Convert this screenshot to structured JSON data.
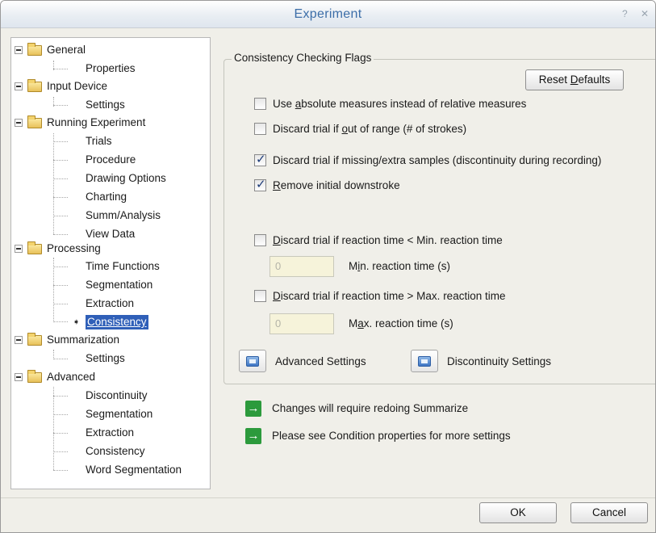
{
  "window": {
    "title": "Experiment",
    "help_glyph": "?",
    "close_glyph": "✕"
  },
  "tree": {
    "general": {
      "label": "General",
      "children": [
        "Properties"
      ]
    },
    "input_device": {
      "label": "Input Device",
      "children": [
        "Settings"
      ]
    },
    "running_experiment": {
      "label": "Running Experiment",
      "children": [
        "Trials",
        "Procedure",
        "Drawing Options",
        "Charting",
        "Summ/Analysis",
        "View Data"
      ]
    },
    "processing": {
      "label": "Processing",
      "children": [
        "Time Functions",
        "Segmentation",
        "Extraction",
        "Consistency"
      ]
    },
    "summarization": {
      "label": "Summarization",
      "children": [
        "Settings"
      ]
    },
    "advanced": {
      "label": "Advanced",
      "children": [
        "Discontinuity",
        "Segmentation",
        "Extraction",
        "Consistency",
        "Word Segmentation"
      ]
    },
    "selected": "Consistency",
    "selected_marker": "➧"
  },
  "panel": {
    "group_title": "Consistency Checking Flags",
    "reset_defaults": {
      "pre": "Reset ",
      "key": "D",
      "post": "efaults"
    },
    "flags": [
      {
        "pre": "Use ",
        "key": "a",
        "post": "bsolute measures instead of relative measures",
        "checked": false
      },
      {
        "pre": "Discard trial if ",
        "key": "o",
        "post": "ut of range (# of strokes)",
        "checked": false
      },
      {
        "pre": "Discard trial if missing/extra samples (discontinuity during recording)",
        "key": "",
        "post": "",
        "checked": true
      },
      {
        "pre": "",
        "key": "R",
        "post": "emove initial downstroke",
        "checked": true
      }
    ],
    "min_rt": {
      "check": {
        "pre": "",
        "key": "D",
        "post": "iscard trial if reaction time < Min. reaction time",
        "checked": false
      },
      "value": "0",
      "label": {
        "pre": "M",
        "key": "i",
        "post": "n. reaction time (s)"
      }
    },
    "max_rt": {
      "check": {
        "pre": "",
        "key": "D",
        "post": "iscard trial if reaction time > Max. reaction time",
        "checked": false
      },
      "value": "0",
      "label": {
        "pre": "M",
        "key": "a",
        "post": "x. reaction time (s)"
      }
    },
    "advanced_settings": "Advanced Settings",
    "discontinuity_settings": "Discontinuity Settings",
    "notes": [
      {
        "icon": "→",
        "text": "Changes will require redoing Summarize"
      },
      {
        "icon": "→",
        "text": "Please see Condition properties for more settings"
      }
    ]
  },
  "footer": {
    "ok": "OK",
    "cancel": "Cancel"
  },
  "colors": {
    "accent": "#2f5fb8",
    "title": "#3c6ea8",
    "note_icon": "#2c9a3c",
    "field_bg": "#f6f3da"
  }
}
